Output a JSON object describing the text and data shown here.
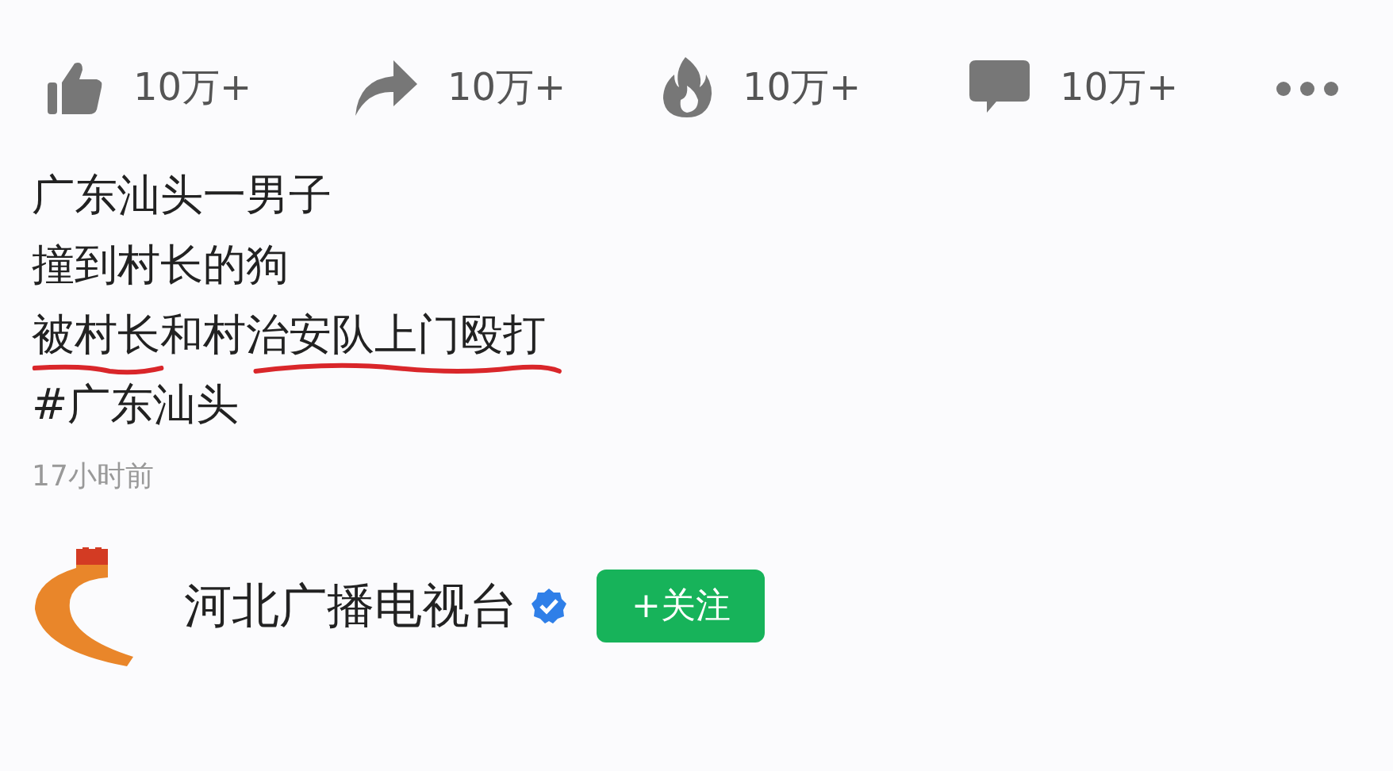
{
  "actions": [
    {
      "kind": "like",
      "count": "10万+"
    },
    {
      "kind": "share",
      "count": "10万+"
    },
    {
      "kind": "hot",
      "count": "10万+"
    },
    {
      "kind": "comment",
      "count": "10万+"
    }
  ],
  "post": {
    "lines": [
      {
        "text": "广东汕头一男子",
        "underlined": false
      },
      {
        "text": "撞到村长的狗",
        "underlined": false
      },
      {
        "text": "被村长和村治安队上门殴打",
        "underlined": true
      },
      {
        "text": "#广东汕头",
        "underlined": false
      }
    ],
    "time": "17小时前"
  },
  "author": {
    "name": "河北广播电视台",
    "verified": true,
    "follow_label": "+关注"
  }
}
